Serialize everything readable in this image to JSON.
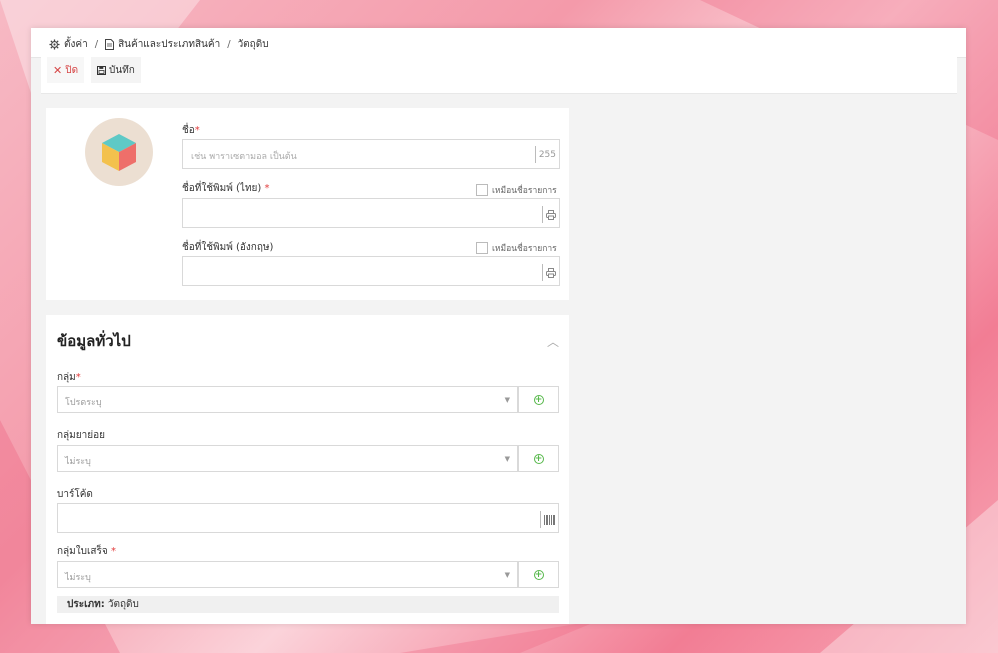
{
  "breadcrumb": {
    "items": [
      {
        "icon": "gear-icon",
        "label": "ตั้งค่า"
      },
      {
        "icon": "document-icon",
        "label": "สินค้าและประเภทสินค้า"
      },
      {
        "icon": "",
        "label": "วัตถุดิบ"
      }
    ],
    "separator": "/"
  },
  "toolbar": {
    "close_label": "ปิด",
    "save_label": "บันทึก"
  },
  "product_card": {
    "name_label": "ชื่อ",
    "name_placeholder": "เช่น พาราเซตามอล เป็นต้น",
    "name_maxlength": "255",
    "print_name_th_label": "ชื่อที่ใช้พิมพ์ (ไทย)",
    "print_name_en_label": "ชื่อที่ใช้พิมพ์ (อังกฤษ)",
    "same_as_item_label": "เหมือนชื่อรายการ",
    "print_icon": "printer-icon",
    "avatar_icon": "cube-icon"
  },
  "general": {
    "title": "ข้อมูลทั่วไป",
    "group_label": "กลุ่ม",
    "group_placeholder": "โปรดระบุ",
    "subgroup_label": "กลุ่มยาย่อย",
    "subgroup_placeholder": "ไม่ระบุ",
    "barcode_label": "บาร์โค้ด",
    "receipt_group_label": "กลุ่มใบเสร็จ",
    "receipt_group_placeholder": "ไม่ระบุ",
    "type_label": "ประเภท:",
    "type_value": "วัตถุดิบ"
  },
  "colors": {
    "accent_red": "#e23c3c",
    "accent_green": "#56b84a"
  }
}
